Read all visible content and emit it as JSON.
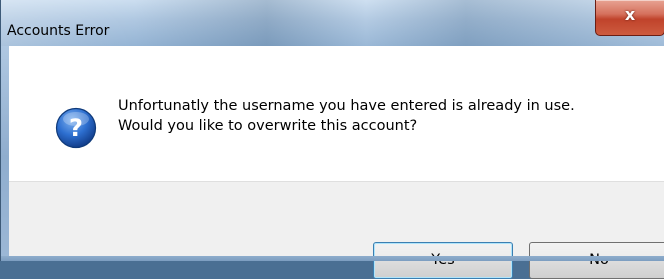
{
  "window": {
    "title": "Accounts Error",
    "close_glyph": "x",
    "close_icon": "close-icon"
  },
  "dialog": {
    "icon": "question-icon",
    "message_lines": [
      "Unfortunatly the username you have entered is already in use.",
      "Would you like to overwrite this account?"
    ]
  },
  "buttons": {
    "yes_label": "Yes",
    "no_label": "No"
  },
  "colors": {
    "titlebar": "#a6c0dc",
    "close_button": "#c0432b",
    "question_icon": "#1f5fb8",
    "button_bar": "#f0f0f0",
    "default_button_border": "#3c7fb1"
  }
}
